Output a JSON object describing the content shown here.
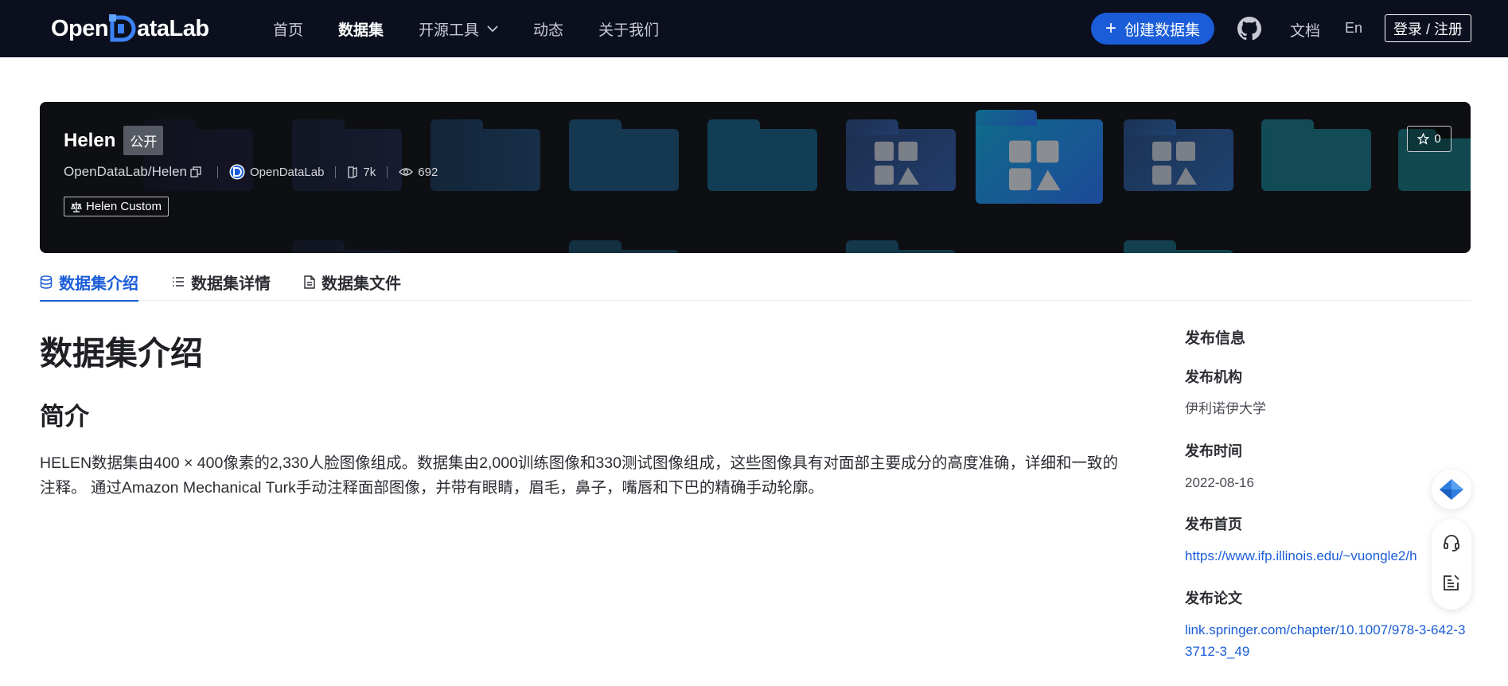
{
  "header": {
    "logo_text_left": "Open",
    "logo_text_right": "ataLab",
    "nav": [
      {
        "label": "首页",
        "active": false
      },
      {
        "label": "数据集",
        "active": true
      },
      {
        "label": "开源工具",
        "active": false,
        "has_dropdown": true
      },
      {
        "label": "动态",
        "active": false
      },
      {
        "label": "关于我们",
        "active": false
      }
    ],
    "create_button": "创建数据集",
    "github_icon": "github-icon",
    "docs_link": "文档",
    "lang_link": "En",
    "login_button": "登录 / 注册"
  },
  "dataset": {
    "name": "Helen",
    "visibility": "公开",
    "path": "OpenDataLab/Helen",
    "publisher": "OpenDataLab",
    "downloads": "7k",
    "views": "692",
    "license": "Helen Custom",
    "stars": "0"
  },
  "tabs": [
    {
      "label": "数据集介绍",
      "active": true,
      "icon": "database-icon"
    },
    {
      "label": "数据集详情",
      "active": false,
      "icon": "list-icon"
    },
    {
      "label": "数据集文件",
      "active": false,
      "icon": "file-icon"
    }
  ],
  "content": {
    "title": "数据集介绍",
    "section": "简介",
    "description": "HELEN数据集由400 × 400像素的2,330人脸图像组成。数据集由2,000训练图像和330测试图像组成，这些图像具有对面部主要成分的高度准确，详细和一致的注释。 通过Amazon Mechanical Turk手动注释面部图像，并带有眼睛，眉毛，鼻子，嘴唇和下巴的精确手动轮廓。"
  },
  "sidebar": {
    "title": "发布信息",
    "org_label": "发布机构",
    "org_value": "伊利诺伊大学",
    "date_label": "发布时间",
    "date_value": "2022-08-16",
    "homepage_label": "发布首页",
    "homepage_value": "https://www.ifp.illinois.edu/~vuongle2/h",
    "paper_label": "发布论文",
    "paper_value": "link.springer.com/chapter/10.1007/978-3-642-33712-3_49"
  },
  "colors": {
    "brand": "#1b5dd8",
    "topbar_bg": "#0b0f1e",
    "banner_bg": "#0d0f12"
  }
}
